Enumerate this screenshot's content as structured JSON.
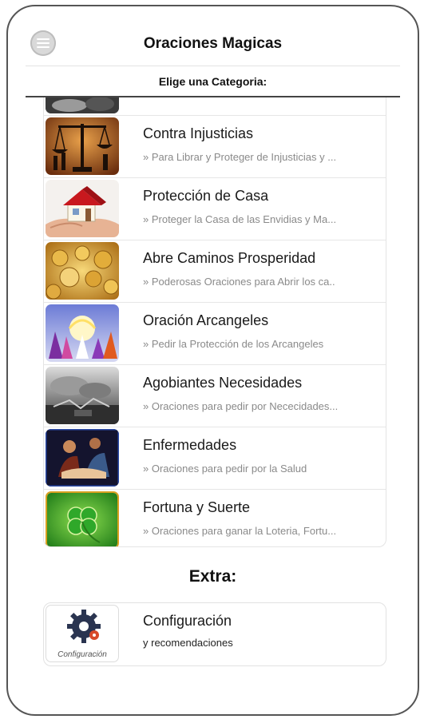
{
  "header": {
    "title": "Oraciones Magicas",
    "menu_icon": "menu-icon"
  },
  "subheader": "Elige una Categoria:",
  "categories": [
    {
      "title": "",
      "subtitle": "",
      "image": "partial-image"
    },
    {
      "title": "Contra Injusticias",
      "subtitle": "» Para Librar y Proteger de Injusticias y ...",
      "image": "scales-of-justice-image"
    },
    {
      "title": "Protección de Casa",
      "subtitle": "» Proteger la Casa de las Envidias y Ma...",
      "image": "house-in-hands-image"
    },
    {
      "title": "Abre Caminos Prosperidad",
      "subtitle": "» Poderosas Oraciones para Abrir los ca..",
      "image": "gold-coins-image"
    },
    {
      "title": "Oración Arcangeles",
      "subtitle": "» Pedir la Protección de los Arcangeles",
      "image": "archangels-image"
    },
    {
      "title": "Agobiantes Necesidades",
      "subtitle": "» Oraciones para pedir por Nececidades...",
      "image": "storm-scene-image"
    },
    {
      "title": "Enfermedades",
      "subtitle": "» Oraciones para pedir por la Salud",
      "image": "healing-scene-image"
    },
    {
      "title": "Fortuna y Suerte",
      "subtitle": "» Oraciones para ganar la Loteria, Fortu...",
      "image": "clover-image"
    }
  ],
  "extra": {
    "heading": "Extra:",
    "title": "Configuración",
    "subtitle": "y recomendaciones",
    "thumb_caption": "Configuración",
    "icon": "gear-icon"
  }
}
